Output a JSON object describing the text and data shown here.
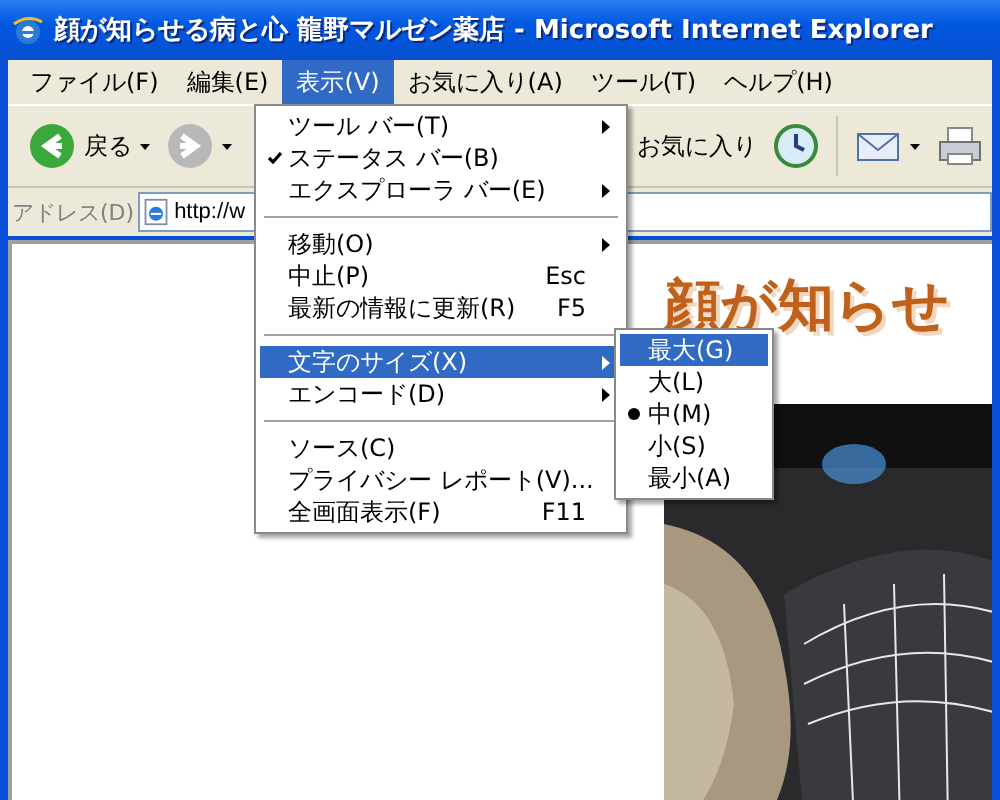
{
  "window": {
    "title": "顔が知らせる病と心 龍野マルゼン薬店 - Microsoft Internet Explorer"
  },
  "menu_bar": [
    {
      "label": "ファイル(F)",
      "selected": false
    },
    {
      "label": "編集(E)",
      "selected": false
    },
    {
      "label": "表示(V)",
      "selected": true
    },
    {
      "label": "お気に入り(A)",
      "selected": false
    },
    {
      "label": "ツール(T)",
      "selected": false
    },
    {
      "label": "ヘルプ(H)",
      "selected": false
    }
  ],
  "toolbar": [
    {
      "kind": "back",
      "label": "戻る",
      "disabled": false
    },
    {
      "kind": "forward",
      "disabled": true
    },
    {
      "kind": "favorites",
      "label": "お気に入り"
    },
    {
      "kind": "history"
    },
    {
      "kind": "mail"
    },
    {
      "kind": "print"
    }
  ],
  "address_bar": {
    "label": "アドレス(D)",
    "value": "http://w"
  },
  "view_menu": {
    "items": [
      {
        "kind": "item",
        "label": "ツール バー(T)",
        "checked": false,
        "submenu": true,
        "selected": false
      },
      {
        "kind": "item",
        "label": "ステータス バー(B)",
        "checked": true,
        "submenu": false,
        "selected": false
      },
      {
        "kind": "item",
        "label": "エクスプローラ バー(E)",
        "checked": false,
        "submenu": true,
        "selected": false
      },
      {
        "kind": "separator"
      },
      {
        "kind": "item",
        "label": "移動(O)",
        "checked": false,
        "submenu": true,
        "selected": false
      },
      {
        "kind": "item",
        "label": "中止(P)",
        "shortcut": "Esc",
        "checked": false,
        "submenu": false,
        "selected": false
      },
      {
        "kind": "item",
        "label": "最新の情報に更新(R)",
        "shortcut": "F5",
        "checked": false,
        "submenu": false,
        "selected": false
      },
      {
        "kind": "separator"
      },
      {
        "kind": "item",
        "label": "文字のサイズ(X)",
        "checked": false,
        "submenu": true,
        "selected": true
      },
      {
        "kind": "item",
        "label": "エンコード(D)",
        "checked": false,
        "submenu": true,
        "selected": false
      },
      {
        "kind": "separator"
      },
      {
        "kind": "item",
        "label": "ソース(C)",
        "checked": false,
        "submenu": false,
        "selected": false
      },
      {
        "kind": "item",
        "label": "プライバシー レポート(V)...",
        "checked": false,
        "submenu": false,
        "selected": false
      },
      {
        "kind": "item",
        "label": "全画面表示(F)",
        "shortcut": "F11",
        "checked": false,
        "submenu": false,
        "selected": false
      }
    ]
  },
  "text_size_menu": {
    "items": [
      {
        "label": "最大(G)",
        "checked": false,
        "selected": true
      },
      {
        "label": "大(L)",
        "checked": false,
        "selected": false
      },
      {
        "label": "中(M)",
        "checked": true,
        "selected": false
      },
      {
        "label": "小(S)",
        "checked": false,
        "selected": false
      },
      {
        "label": "最小(A)",
        "checked": false,
        "selected": false
      }
    ]
  },
  "page": {
    "heading": "顔が知らせ"
  }
}
